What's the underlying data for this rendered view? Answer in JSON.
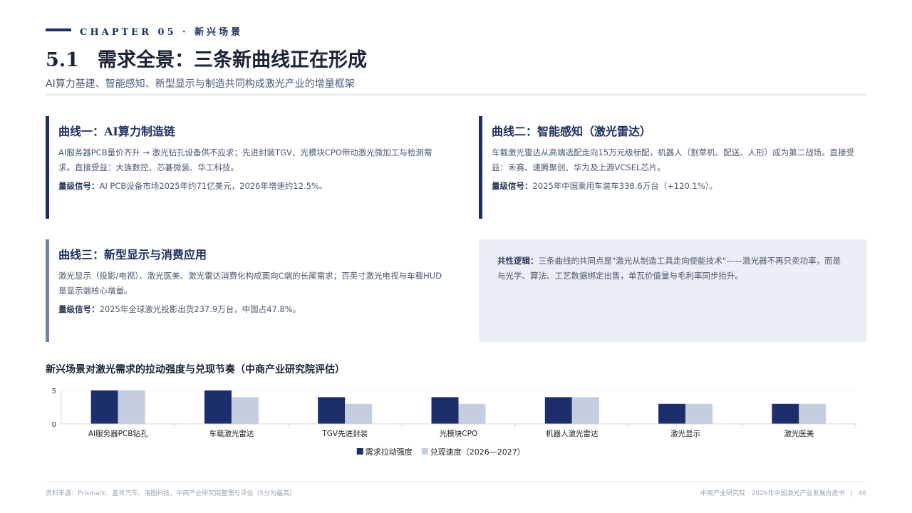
{
  "header": {
    "chapter": "CHAPTER 05 · 新兴场景",
    "section_number": "5.1",
    "title": "需求全景：三条新曲线正在形成",
    "subtitle": "AI算力基建、智能感知、新型显示与制造共同构成激光产业的增量框架"
  },
  "cards": [
    {
      "title": "曲线一：AI算力制造链",
      "body": "AI服务器PCB量价齐升 → 激光钻孔设备供不应求；先进封装TGV、光模块CPO带动激光微加工与检测需求。直接受益：大族数控、芯碁微装、华工科技。",
      "signal_label": "量级信号：",
      "signal": "AI PCB设备市场2025年约71亿美元，2026年增速约12.5%。"
    },
    {
      "title": "曲线二：智能感知（激光雷达）",
      "body": "车载激光雷达从高端选配走向15万元级标配，机器人（割草机、配送、人形）成为第二战场。直接受益：禾赛、速腾聚创、华为及上游VCSEL芯片。",
      "signal_label": "量级信号：",
      "signal": "2025年中国乘用车装车338.6万台（+120.1%）。"
    },
    {
      "title": "曲线三：新型显示与消费应用",
      "body": "激光显示（投影/电视）、激光医美、激光雷达消费化构成面向C端的长尾需求；百英寸激光电视与车载HUD是显示端核心增量。",
      "signal_label": "量级信号：",
      "signal": "2025年全球激光投影出货237.9万台，中国占47.8%。"
    }
  ],
  "note": {
    "label": "共性逻辑：",
    "text": "三条曲线的共同点是\"激光从制造工具走向使能技术\"——激光器不再只卖功率，而是与光学、算法、工艺数据绑定出售，单瓦价值量与毛利率同步抬升。"
  },
  "chart_data": {
    "type": "bar",
    "title": "新兴场景对激光需求的拉动强度与兑现节奏（中商产业研究院评估）",
    "categories": [
      "AI服务器PCB钻孔",
      "车载激光雷达",
      "TGV先进封装",
      "光模块CPO",
      "机器人激光雷达",
      "激光显示",
      "激光医美"
    ],
    "series": [
      {
        "name": "需求拉动强度",
        "values": [
          5,
          5,
          4,
          4,
          4,
          3,
          3
        ],
        "color": "#1c2f6b"
      },
      {
        "name": "兑现速度（2026—2027）",
        "values": [
          5,
          4,
          3,
          3,
          4,
          3,
          3
        ],
        "color": "#c5cee0"
      }
    ],
    "ylim": [
      0,
      5
    ],
    "yticks": [
      0,
      5
    ],
    "legend": "bottom-center",
    "grid": true
  },
  "footer": {
    "source": "资料来源：Prismark、盖世汽车、洛图科技，中商产业研究院整理与评估（5分为最高）",
    "publisher": "中商产业研究院 · 2026年中国激光产业发展白皮书",
    "separator": "|",
    "page": "46"
  }
}
